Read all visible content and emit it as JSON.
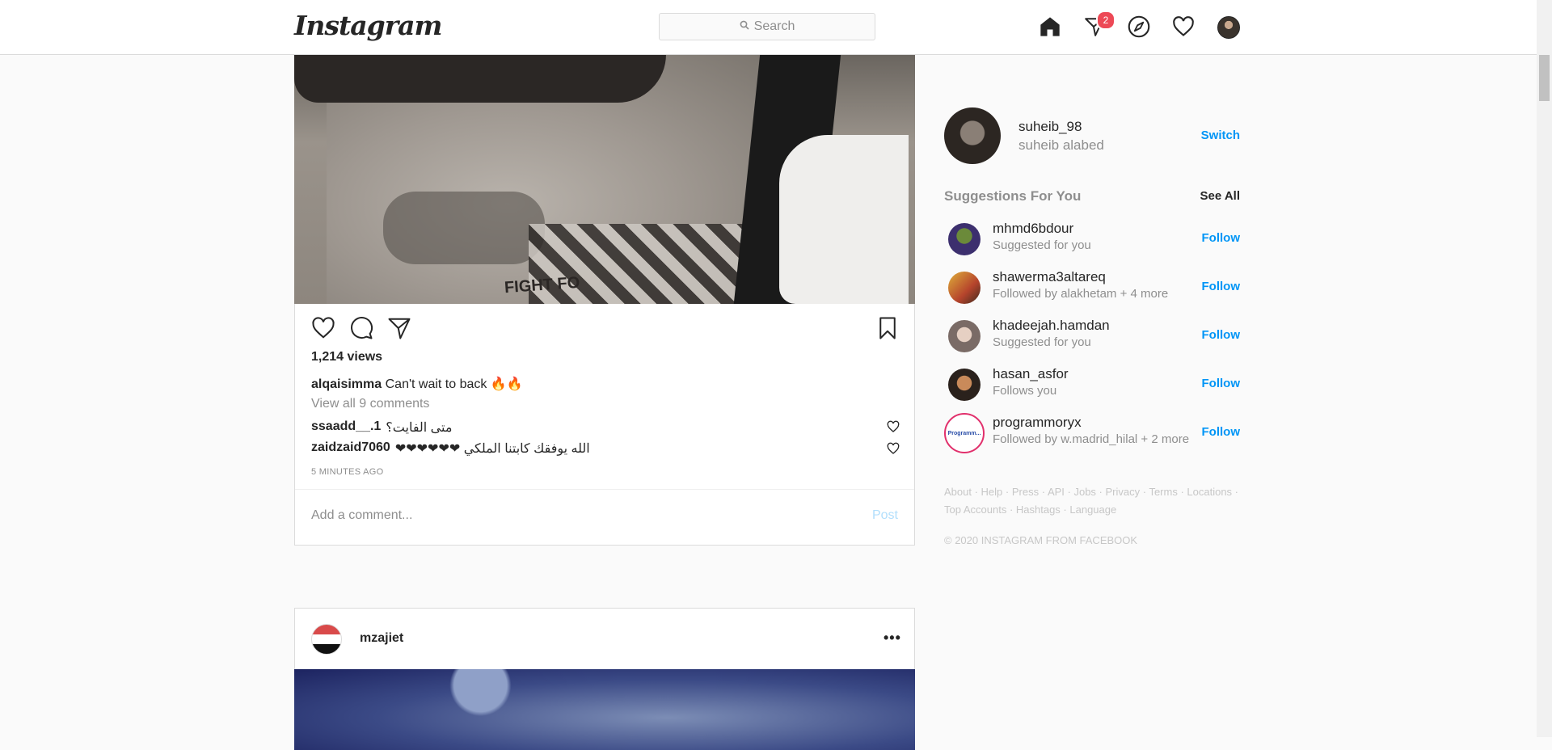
{
  "app": {
    "logo": "Instagram"
  },
  "nav": {
    "search_placeholder": "Search",
    "icons": [
      "home-icon",
      "direct-messages-icon",
      "explore-icon",
      "activity-heart-icon",
      "profile-avatar"
    ],
    "direct_badge": "2"
  },
  "post1": {
    "views": "1,214 views",
    "caption_user": "alqaisimma",
    "caption_text": "Can't wait to back 🔥🔥",
    "view_all": "View all 9 comments",
    "comments": [
      {
        "user": "ssaadd__.1",
        "text": "متى الفايت؟"
      },
      {
        "user": "zaidzaid7060",
        "text": "الله يوفقك كابتنا الملكي ❤❤❤❤❤❤"
      }
    ],
    "photo_text": "FIGHT FO",
    "time": "5 minutes ago",
    "add_comment_placeholder": "Add a comment...",
    "post_button": "Post"
  },
  "post2": {
    "user": "mzajiet",
    "more": "•••"
  },
  "sidebar": {
    "username": "suheib_98",
    "fullname": "suheib alabed",
    "switch": "Switch",
    "suggestions_title": "Suggestions For You",
    "see_all": "See All",
    "suggestions": [
      {
        "user": "mhmd6bdour",
        "sub": "Suggested for you",
        "follow": "Follow"
      },
      {
        "user": "shawerma3altareq",
        "sub": "Followed by alakhetam + 4 more",
        "follow": "Follow"
      },
      {
        "user": "khadeejah.hamdan",
        "sub": "Suggested for you",
        "follow": "Follow"
      },
      {
        "user": "hasan_asfor",
        "sub": "Follows you",
        "follow": "Follow"
      },
      {
        "user": "programmoryx",
        "sub": "Followed by w.madrid_hilal + 2 more",
        "follow": "Follow",
        "avatar_text": "Programm..."
      }
    ],
    "footer_links": [
      "About",
      "Help",
      "Press",
      "API",
      "Jobs",
      "Privacy",
      "Terms",
      "Locations",
      "Top Accounts",
      "Hashtags",
      "Language"
    ],
    "copyright": "© 2020 Instagram from Facebook"
  },
  "colors": {
    "accent": "#0095f6",
    "badge": "#ed4956",
    "post_disabled": "#b2dffc"
  }
}
